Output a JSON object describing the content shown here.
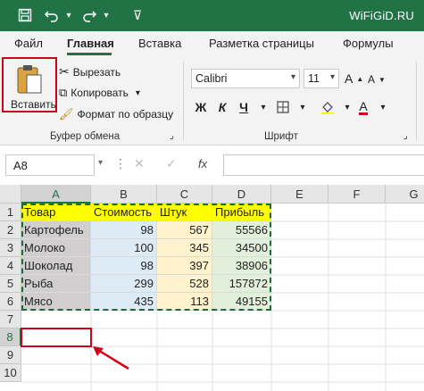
{
  "titlebar": {
    "site": "WiFiGiD.RU"
  },
  "tabs": [
    "Файл",
    "Главная",
    "Вставка",
    "Разметка страницы",
    "Формулы"
  ],
  "clipboard": {
    "paste": "Вставить",
    "cut": "Вырезать",
    "copy": "Копировать",
    "format_painter": "Формат по образцу",
    "group_label": "Буфер обмена"
  },
  "font": {
    "name": "Calibri",
    "size": "11",
    "bold": "Ж",
    "italic": "К",
    "underline": "Ч",
    "color_letter": "A",
    "group_label": "Шрифт"
  },
  "formula_bar": {
    "name_box": "A8",
    "fx": "fx",
    "value": ""
  },
  "columns": [
    "A",
    "B",
    "C",
    "D",
    "E",
    "F",
    "G"
  ],
  "rows": [
    "1",
    "2",
    "3",
    "4",
    "5",
    "6",
    "7",
    "8",
    "9",
    "10"
  ],
  "table": {
    "headers": [
      "Товар",
      "Стоимость",
      "Штук",
      "Прибыль"
    ],
    "rows": [
      [
        "Картофель",
        "98",
        "567",
        "55566"
      ],
      [
        "Молоко",
        "100",
        "345",
        "34500"
      ],
      [
        "Шоколад",
        "98",
        "397",
        "38906"
      ],
      [
        "Рыба",
        "299",
        "528",
        "157872"
      ],
      [
        "Мясо",
        "435",
        "113",
        "49155"
      ]
    ]
  },
  "colors": {
    "excel_green": "#217346",
    "header_yellow": "#ffff00",
    "colA_fill": "#d0cece",
    "colB_fill": "#ddebf7",
    "colC_fill": "#fff2cc",
    "colD_fill": "#e2efda",
    "highlight_red": "#d0021b"
  }
}
